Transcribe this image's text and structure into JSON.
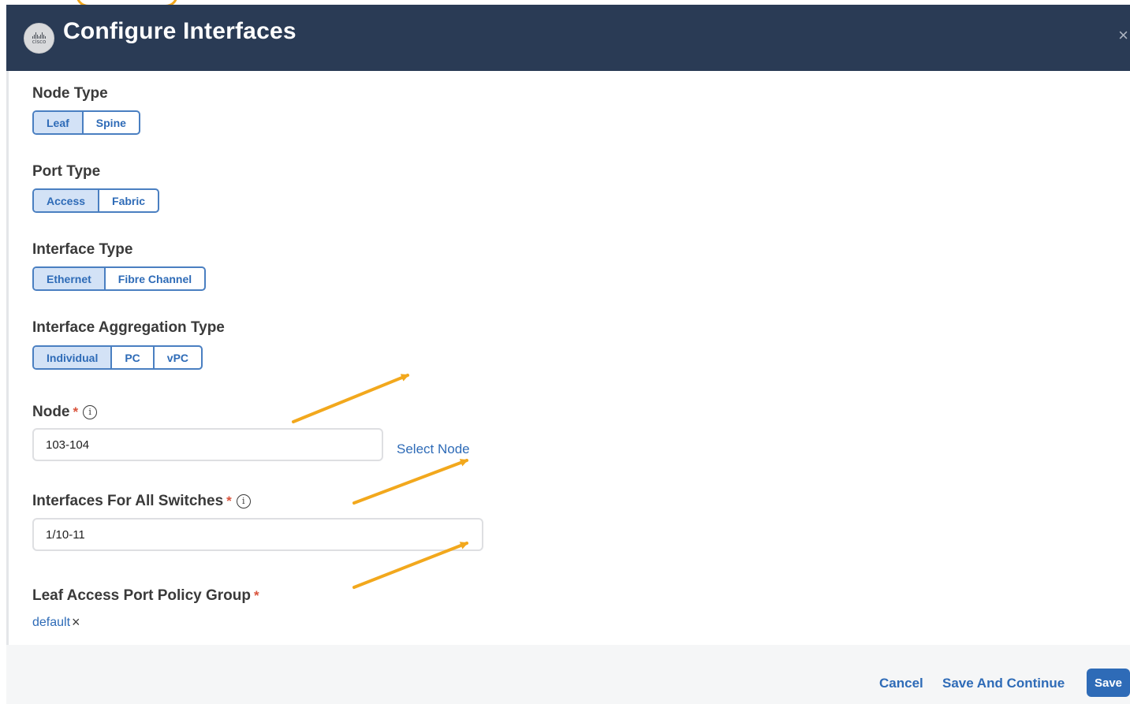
{
  "header": {
    "logo_text": "cisco",
    "title": "Configure Interfaces",
    "close_icon": "×"
  },
  "node_type": {
    "label": "Node Type",
    "options": [
      "Leaf",
      "Spine"
    ],
    "selected": "Leaf"
  },
  "port_type": {
    "label": "Port Type",
    "options": [
      "Access",
      "Fabric"
    ],
    "selected": "Access"
  },
  "interface_type": {
    "label": "Interface Type",
    "options": [
      "Ethernet",
      "Fibre Channel"
    ],
    "selected": "Ethernet"
  },
  "aggregation_type": {
    "label": "Interface Aggregation Type",
    "options": [
      "Individual",
      "PC",
      "vPC"
    ],
    "selected": "Individual"
  },
  "node": {
    "label": "Node",
    "required_mark": "*",
    "info_icon": "i",
    "value": "103-104",
    "select_link": "Select Node"
  },
  "interfaces": {
    "label": "Interfaces For All Switches",
    "required_mark": "*",
    "info_icon": "i",
    "value": "1/10-11"
  },
  "policy_group": {
    "label": "Leaf Access Port Policy Group",
    "required_mark": "*",
    "value": "default",
    "remove_icon": "×"
  },
  "footer": {
    "cancel_label": "Cancel",
    "save_continue_label": "Save And Continue",
    "save_label": "Save"
  },
  "colors": {
    "header_bg": "#2a3b55",
    "accent": "#2e6bb7",
    "annotation_arrow": "#f2a81d",
    "required": "#d9533c"
  }
}
